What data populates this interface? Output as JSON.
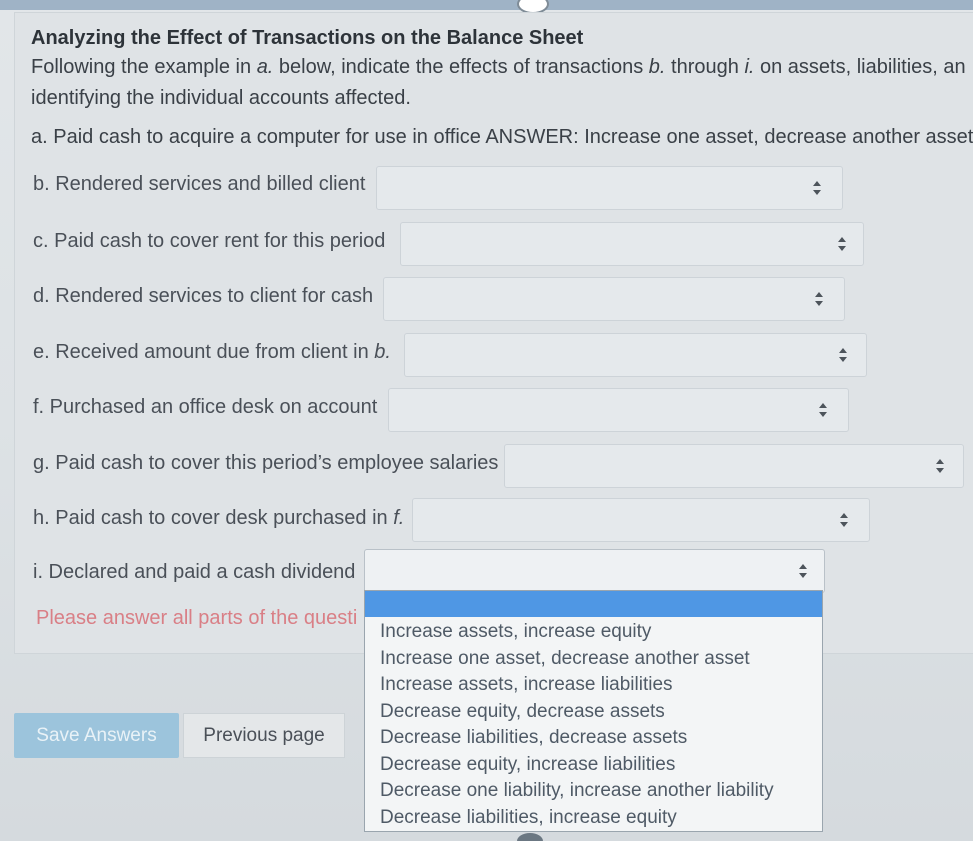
{
  "header": {
    "title": "Analyzing the Effect of Transactions on the Balance Sheet",
    "instructions_line1_pre": "Following the example in ",
    "instructions_line1_a": "a.",
    "instructions_line1_mid": " below, indicate the effects of transactions ",
    "instructions_line1_b": "b.",
    "instructions_line1_through": " through ",
    "instructions_line1_i": "i.",
    "instructions_line1_post": " on assets, liabilities, an",
    "instructions_line2": "identifying the individual accounts affected.",
    "example": "a. Paid cash to acquire a computer for use in office  ANSWER: Increase one asset, decrease another asset"
  },
  "questions": [
    {
      "label": "b. Rendered services and billed client",
      "value": ""
    },
    {
      "label": "c. Paid cash to cover rent for this period",
      "value": ""
    },
    {
      "label": "d. Rendered services to client for cash",
      "value": ""
    },
    {
      "label_pre": "e. Received amount due from client in ",
      "label_em": "b.",
      "value": ""
    },
    {
      "label": "f. Purchased an office desk on account",
      "value": ""
    },
    {
      "label": "g. Paid cash to cover this period’s employee salaries",
      "value": ""
    },
    {
      "label_pre": "h. Paid cash to cover desk purchased in ",
      "label_em": "f.",
      "value": ""
    },
    {
      "label": "i. Declared and paid a cash dividend",
      "value": ""
    }
  ],
  "error_message": "Please answer all parts of the questi",
  "dropdown": {
    "options": [
      "Increase assets, increase equity",
      "Increase one asset, decrease another asset",
      "Increase assets, increase liabilities",
      "Decrease equity, decrease assets",
      "Decrease liabilities, decrease assets",
      "Decrease equity, increase liabilities",
      "Decrease one liability, increase another liability",
      "Decrease liabilities, increase equity"
    ]
  },
  "buttons": {
    "save": "Save Answers",
    "previous": "Previous page"
  },
  "icons": {
    "select_arrows": "up-down-arrows-icon"
  },
  "colors": {
    "highlight": "#4f97e4",
    "error": "#d97f86",
    "save_button": "#9cc4dc"
  }
}
